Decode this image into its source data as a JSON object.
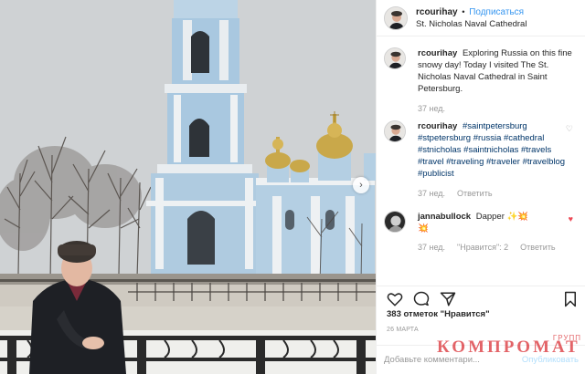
{
  "post": {
    "username": "rcourihay",
    "follow_label": "Подписаться",
    "separator": "•",
    "location": "St. Nicholas Naval Cathedral"
  },
  "comments": [
    {
      "username": "rcourihay",
      "text": "Exploring Russia on this fine snowy day! Today I visited The St. Nicholas Naval Cathedral in Saint Petersburg.",
      "age": "37 нед."
    },
    {
      "username": "rcourihay",
      "hashtags": [
        "#saintpetersburg",
        "#stpetersburg",
        "#russia",
        "#cathedral",
        "#stnicholas",
        "#saintnicholas",
        "#travels",
        "#travel",
        "#traveling",
        "#traveler",
        "#travelblog",
        "#publicist"
      ],
      "age": "37 нед.",
      "reply_label": "Ответить"
    },
    {
      "username": "jannabullock",
      "text": "Dapper",
      "emoji": "✨💥",
      "emoji2": "💥",
      "age": "37 нед.",
      "likes_label": "\"Нравится\": 2",
      "reply_label": "Ответить"
    }
  ],
  "actions": {
    "like_icon": "heart-outline-icon",
    "comment_icon": "comment-bubble-icon",
    "share_icon": "paper-plane-icon",
    "save_icon": "bookmark-icon"
  },
  "likes_text": "383 отметок \"Нравится\"",
  "date_text": "26 МАРТА",
  "add_comment": {
    "placeholder": "Добавьте комментари...",
    "publish_label": "Опубликовать"
  },
  "watermark": {
    "main": "КОМПРОМАТ",
    "sub": "ГРУПП"
  },
  "colors": {
    "accent": "#3897f0",
    "hashtag": "#003569",
    "muted": "#999999",
    "like_red": "#ed4956",
    "watermark_red": "#d8282e"
  }
}
